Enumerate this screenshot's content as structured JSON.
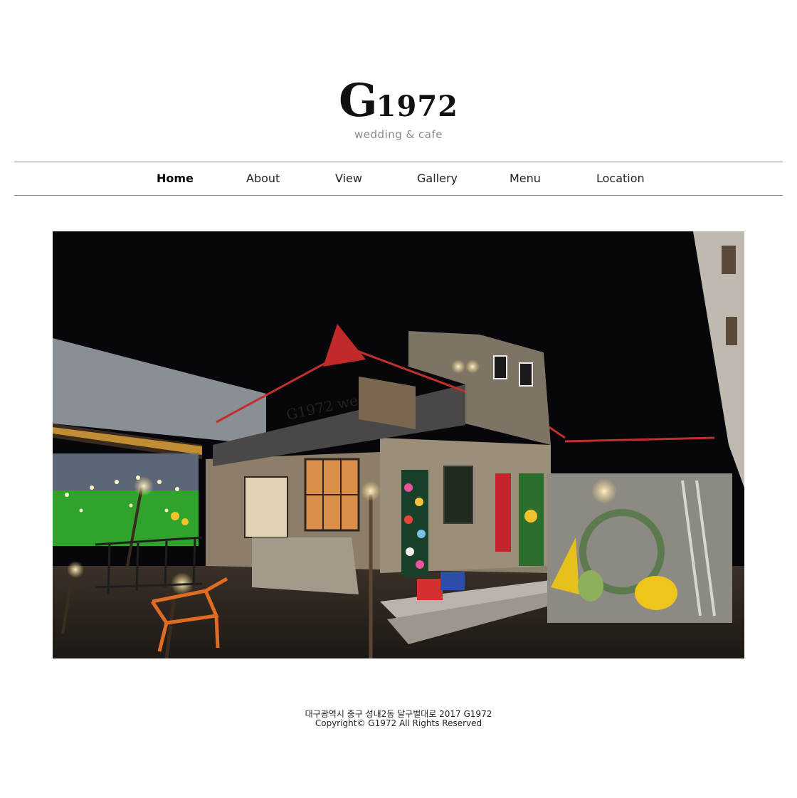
{
  "brand": {
    "logo_letter": "G",
    "logo_number": "1972",
    "tagline": "wedding & cafe"
  },
  "nav": {
    "items": [
      {
        "label": "Home",
        "active": true
      },
      {
        "label": "About",
        "active": false
      },
      {
        "label": "View",
        "active": false
      },
      {
        "label": "Gallery",
        "active": false
      },
      {
        "label": "Menu",
        "active": false
      },
      {
        "label": "Location",
        "active": false
      }
    ]
  },
  "hero": {
    "sign_text": "G1972 wedding"
  },
  "footer": {
    "address": "대구광역시 중구 성내2동 달구벌대로 2017 G1972",
    "copyright": "Copyright© G1972 All Rights Reserved"
  }
}
